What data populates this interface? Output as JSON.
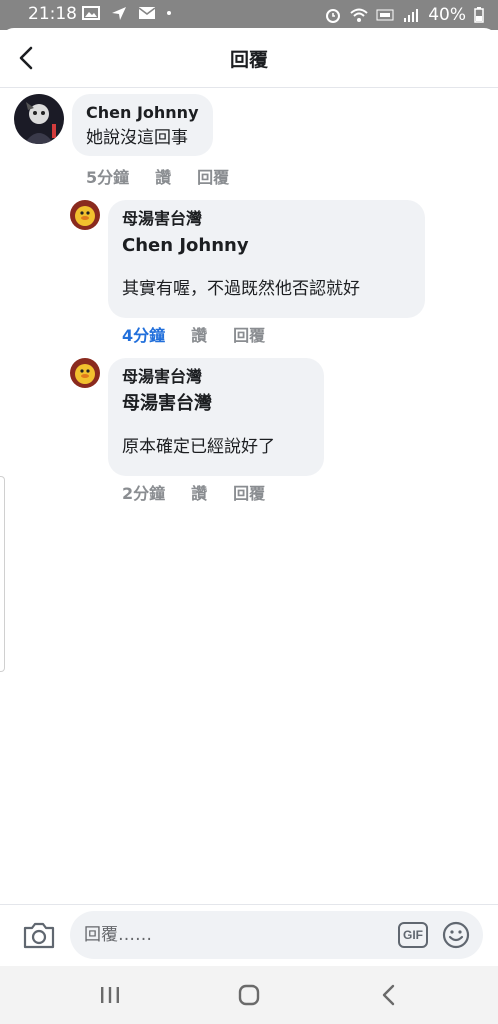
{
  "status_bar": {
    "time": "21:18",
    "battery": "40%",
    "icons": [
      "image-icon",
      "navigation-icon",
      "mail-icon",
      "dot-icon",
      "alarm-icon",
      "wifi-icon",
      "volte-icon",
      "signal-icon",
      "battery-icon"
    ]
  },
  "header": {
    "title": "回覆",
    "back_icon": "back-chevron-icon"
  },
  "comments": [
    {
      "author": "Chen Johnny",
      "text": "她說沒這回事",
      "time": "5分鐘",
      "like": "讚",
      "reply": "回覆"
    },
    {
      "author": "母湯害台灣",
      "mention": "Chen Johnny",
      "text": "其實有喔，不過既然他否認就好",
      "time": "4分鐘",
      "like": "讚",
      "reply": "回覆"
    },
    {
      "author": "母湯害台灣",
      "mention": "母湯害台灣",
      "text": "原本確定已經說好了",
      "time": "2分鐘",
      "like": "讚",
      "reply": "回覆"
    }
  ],
  "composer": {
    "placeholder": "回覆……",
    "gif_label": "GIF",
    "camera_icon": "camera-icon",
    "emoji_icon": "emoji-icon"
  },
  "colors": {
    "accent_blue": "#216fdb",
    "bubble": "#f0f2f5",
    "meta_gray": "#8a8d91",
    "status_bar": "#858585"
  }
}
